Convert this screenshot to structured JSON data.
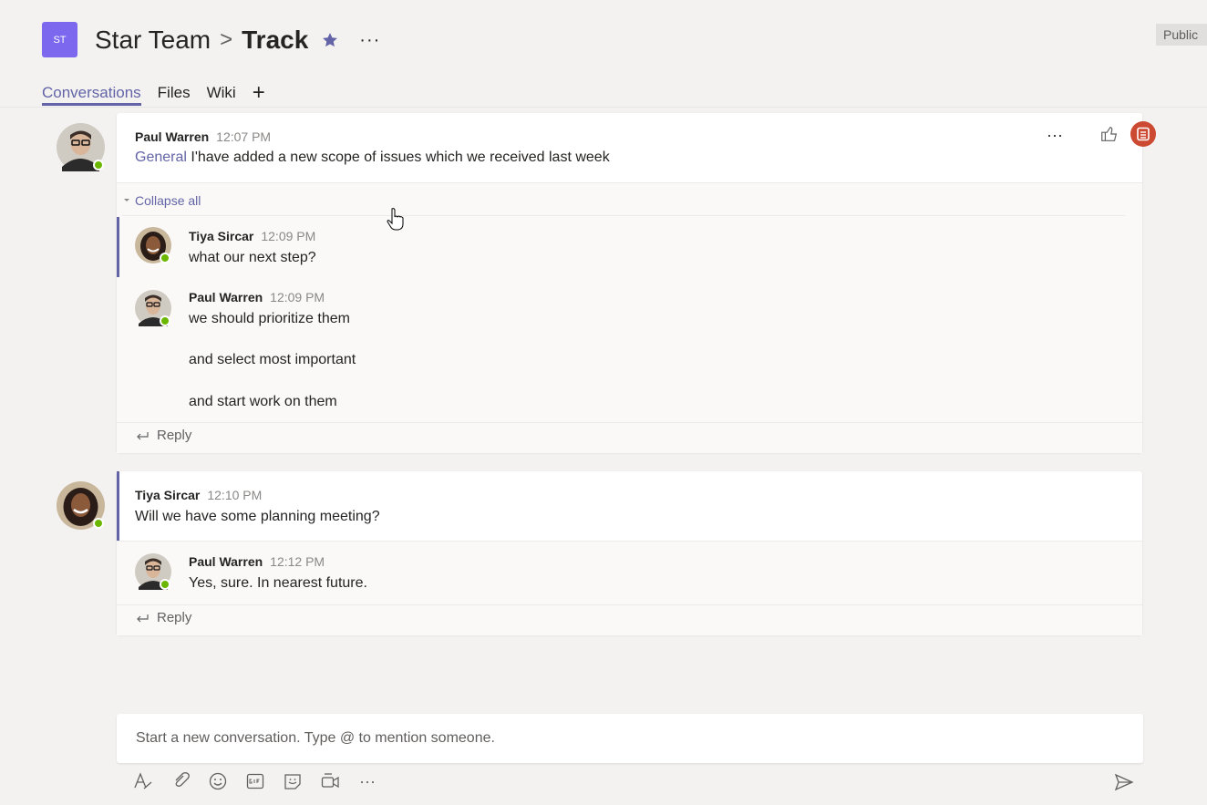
{
  "header": {
    "team_initials": "ST",
    "team_name": "Star Team",
    "separator": ">",
    "channel_name": "Track",
    "more": "···",
    "public_label": "Public"
  },
  "tabs": [
    {
      "label": "Conversations",
      "active": true
    },
    {
      "label": "Files",
      "active": false
    },
    {
      "label": "Wiki",
      "active": false
    }
  ],
  "tab_add": "+",
  "thread1": {
    "author": "Paul Warren",
    "time": "12:07 PM",
    "channel_tag": "General",
    "text": "I'have added a new scope of issues which we received last week",
    "more": "···",
    "collapse_label": "Collapse all",
    "replies": [
      {
        "author": "Tiya Sircar",
        "time": "12:09 PM",
        "lines": [
          "what our next step?"
        ]
      },
      {
        "author": "Paul Warren",
        "time": "12:09 PM",
        "lines": [
          "we should prioritize them",
          "and select most important",
          "and start work on them"
        ]
      }
    ],
    "reply_label": "Reply"
  },
  "thread2": {
    "author": "Tiya Sircar",
    "time": "12:10 PM",
    "text": "Will we have some planning meeting?",
    "replies": [
      {
        "author": "Paul Warren",
        "time": "12:12 PM",
        "lines": [
          "Yes, sure. In nearest future."
        ]
      }
    ],
    "reply_label": "Reply"
  },
  "composer": {
    "placeholder": "Start a new conversation. Type @ to mention someone.",
    "more": "···"
  },
  "colors": {
    "accent": "#6264a7",
    "status_available": "#6bb700",
    "bot_badge": "#cc4a31"
  }
}
